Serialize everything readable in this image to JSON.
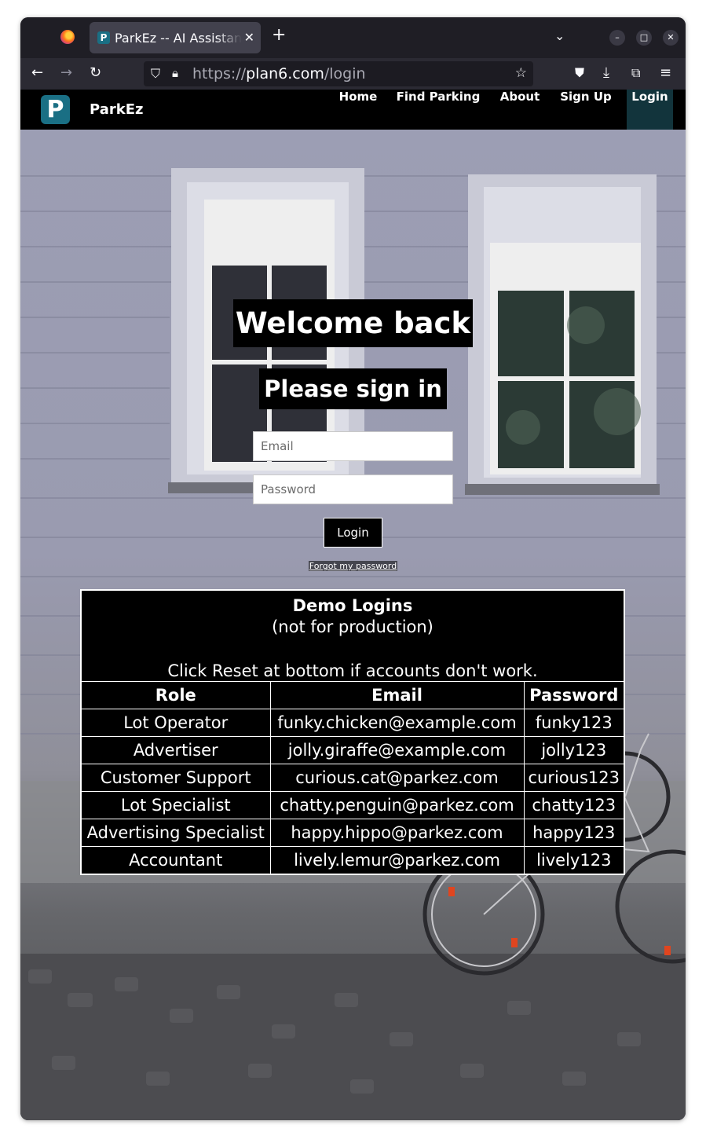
{
  "browser": {
    "tab_title": "ParkEz -- AI Assistant",
    "tab_favicon": "P",
    "url_scheme": "https://",
    "url_host": "plan6.com",
    "url_path": "/login",
    "icons": [
      "firefox-icon",
      "back-icon",
      "forward-icon",
      "reload-icon",
      "shield-icon",
      "lock-icon",
      "star-icon",
      "pocket-icon",
      "download-icon",
      "extensions-icon",
      "menu-icon"
    ]
  },
  "site": {
    "logo_letter": "P",
    "brand": "ParkEz",
    "nav": {
      "home": "Home",
      "find_parking": "Find Parking",
      "about": "About",
      "sign_up": "Sign Up",
      "login": "Login"
    },
    "accent_color": "#1a6f84"
  },
  "login": {
    "title": "Welcome back",
    "subtitle": "Please sign in",
    "email_placeholder": "Email",
    "password_placeholder": "Password",
    "button": "Login",
    "forgot": "Forgot my password"
  },
  "demo": {
    "title": "Demo Logins",
    "note": "(not for production)",
    "hint": "Click Reset at bottom if accounts don't work.",
    "headers": {
      "role": "Role",
      "email": "Email",
      "password": "Password"
    },
    "rows": [
      {
        "role": "Lot Operator",
        "email": "funky.chicken@example.com",
        "password": "funky123"
      },
      {
        "role": "Advertiser",
        "email": "jolly.giraffe@example.com",
        "password": "jolly123"
      },
      {
        "role": "Customer Support",
        "email": "curious.cat@parkez.com",
        "password": "curious123"
      },
      {
        "role": "Lot Specialist",
        "email": "chatty.penguin@parkez.com",
        "password": "chatty123"
      },
      {
        "role": "Advertising Specialist",
        "email": "happy.hippo@parkez.com",
        "password": "happy123"
      },
      {
        "role": "Accountant",
        "email": "lively.lemur@parkez.com",
        "password": "lively123"
      }
    ]
  }
}
